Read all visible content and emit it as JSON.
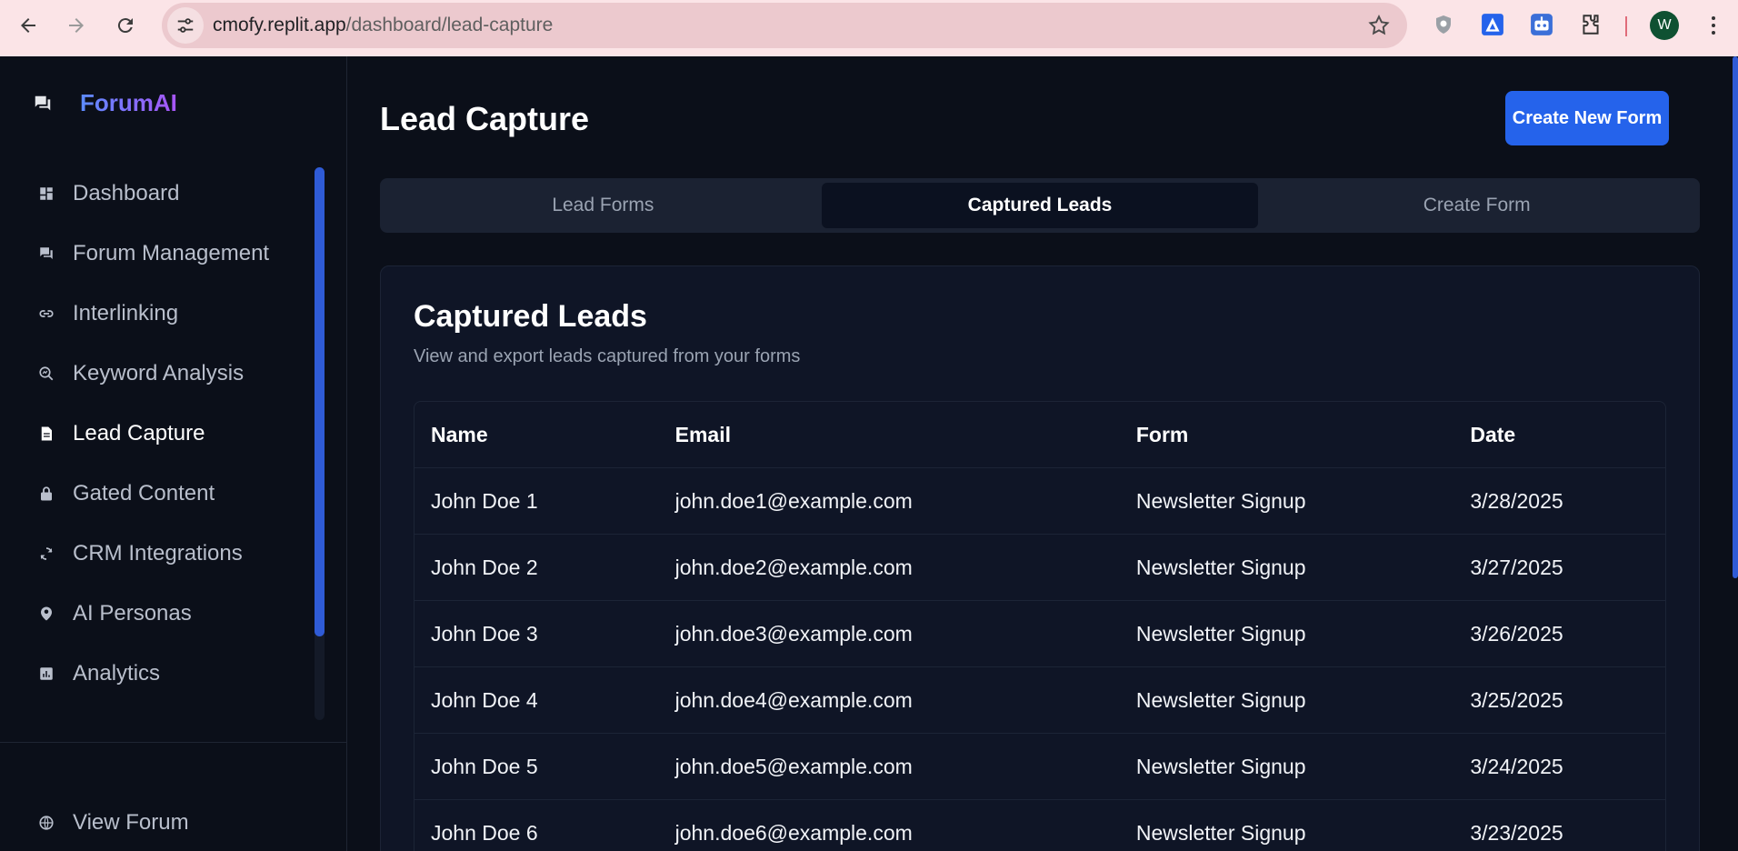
{
  "browser": {
    "url_host": "cmofy.replit.app",
    "url_path": "/dashboard/lead-capture",
    "profile_initial": "W"
  },
  "sidebar": {
    "brand": "ForumAI",
    "items": [
      {
        "label": "Dashboard",
        "icon": "dashboard-icon"
      },
      {
        "label": "Forum Management",
        "icon": "chat-icon"
      },
      {
        "label": "Interlinking",
        "icon": "link-icon"
      },
      {
        "label": "Keyword Analysis",
        "icon": "search-chart-icon"
      },
      {
        "label": "Lead Capture",
        "icon": "document-icon",
        "active": true
      },
      {
        "label": "Gated Content",
        "icon": "lock-icon"
      },
      {
        "label": "CRM Integrations",
        "icon": "sync-icon"
      },
      {
        "label": "AI Personas",
        "icon": "person-pin-icon"
      },
      {
        "label": "Analytics",
        "icon": "analytics-icon"
      }
    ],
    "footer_item": "View Forum"
  },
  "header": {
    "title": "Lead Capture",
    "create_button": "Create New Form"
  },
  "tabs": [
    {
      "label": "Lead Forms"
    },
    {
      "label": "Captured Leads",
      "active": true
    },
    {
      "label": "Create Form"
    }
  ],
  "card": {
    "title": "Captured Leads",
    "subtitle": "View and export leads captured from your forms"
  },
  "table": {
    "columns": [
      "Name",
      "Email",
      "Form",
      "Date"
    ],
    "rows": [
      [
        "John Doe 1",
        "john.doe1@example.com",
        "Newsletter Signup",
        "3/28/2025"
      ],
      [
        "John Doe 2",
        "john.doe2@example.com",
        "Newsletter Signup",
        "3/27/2025"
      ],
      [
        "John Doe 3",
        "john.doe3@example.com",
        "Newsletter Signup",
        "3/26/2025"
      ],
      [
        "John Doe 4",
        "john.doe4@example.com",
        "Newsletter Signup",
        "3/25/2025"
      ],
      [
        "John Doe 5",
        "john.doe5@example.com",
        "Newsletter Signup",
        "3/24/2025"
      ],
      [
        "John Doe 6",
        "john.doe6@example.com",
        "Newsletter Signup",
        "3/23/2025"
      ]
    ]
  },
  "colors": {
    "accent": "#2563eb",
    "background": "#0b0f19",
    "card": "#0f1526"
  }
}
